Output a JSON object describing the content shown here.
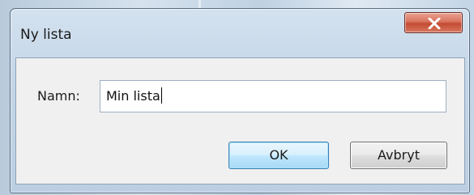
{
  "dialog": {
    "title": "Ny lista",
    "close_label": "X"
  },
  "form": {
    "name_label": "Namn:",
    "name_value": "Min lista"
  },
  "buttons": {
    "ok_label": "OK",
    "cancel_label": "Avbryt"
  },
  "colors": {
    "close_button": "#c34a33",
    "ok_border": "#3c7fb1",
    "client_bg": "#f0f0f0"
  }
}
